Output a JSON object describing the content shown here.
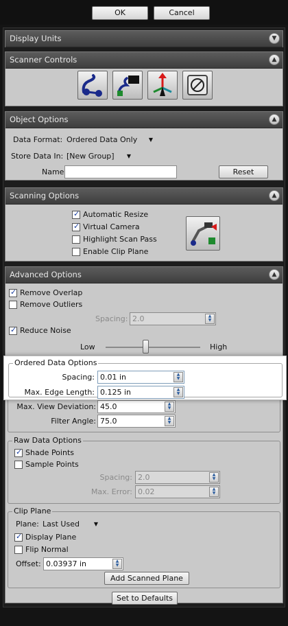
{
  "dialog": {
    "ok_label": "OK",
    "cancel_label": "Cancel",
    "defaults_label": "Set to Defaults"
  },
  "display_units": {
    "title": "Display Units"
  },
  "scanner_controls": {
    "title": "Scanner Controls",
    "tools": [
      "scan-arm-icon",
      "scan-to-object-icon",
      "coordinate-axes-icon",
      "scanner-settings-icon"
    ]
  },
  "object_options": {
    "title": "Object Options",
    "data_format_label": "Data Format:",
    "data_format_value": "Ordered Data Only",
    "store_data_label": "Store Data In:",
    "store_data_value": "[New Group]",
    "name_label": "Name:",
    "name_value": "",
    "reset_label": "Reset"
  },
  "scanning_options": {
    "title": "Scanning Options",
    "checks": [
      {
        "label": "Automatic Resize",
        "checked": true
      },
      {
        "label": "Virtual Camera",
        "checked": true
      },
      {
        "label": "Highlight Scan Pass",
        "checked": false
      },
      {
        "label": "Enable Clip Plane",
        "checked": false
      }
    ]
  },
  "advanced_options": {
    "title": "Advanced Options",
    "remove_overlap": {
      "label": "Remove Overlap",
      "checked": true
    },
    "remove_outliers": {
      "label": "Remove Outliers",
      "checked": false
    },
    "spacing_label": "Spacing:",
    "spacing_value": "2.0",
    "reduce_noise": {
      "label": "Reduce Noise",
      "checked": true
    },
    "noise_low": "Low",
    "noise_high": "High",
    "noise_level": 0.42,
    "ordered": {
      "title": "Ordered Data Options",
      "spacing_label": "Spacing:",
      "spacing_value": "0.01 in",
      "edge_label": "Max. Edge Length:",
      "edge_value": "0.125 in",
      "view_label": "Max. View Deviation:",
      "view_value": "45.0",
      "filter_label": "Filter Angle:",
      "filter_value": "75.0"
    },
    "raw": {
      "title": "Raw Data Options",
      "shade_points": {
        "label": "Shade Points",
        "checked": true
      },
      "sample_points": {
        "label": "Sample Points",
        "checked": false
      },
      "spacing_label": "Spacing:",
      "spacing_value": "2.0",
      "max_error_label": "Max. Error:",
      "max_error_value": "0.02"
    },
    "clip": {
      "title": "Clip Plane",
      "plane_label": "Plane:",
      "plane_value": "Last Used",
      "display_plane": {
        "label": "Display Plane",
        "checked": true
      },
      "flip_normal": {
        "label": "Flip Normal",
        "checked": false
      },
      "offset_label": "Offset:",
      "offset_value": "0.03937 in",
      "add_plane_label": "Add Scanned Plane"
    }
  }
}
